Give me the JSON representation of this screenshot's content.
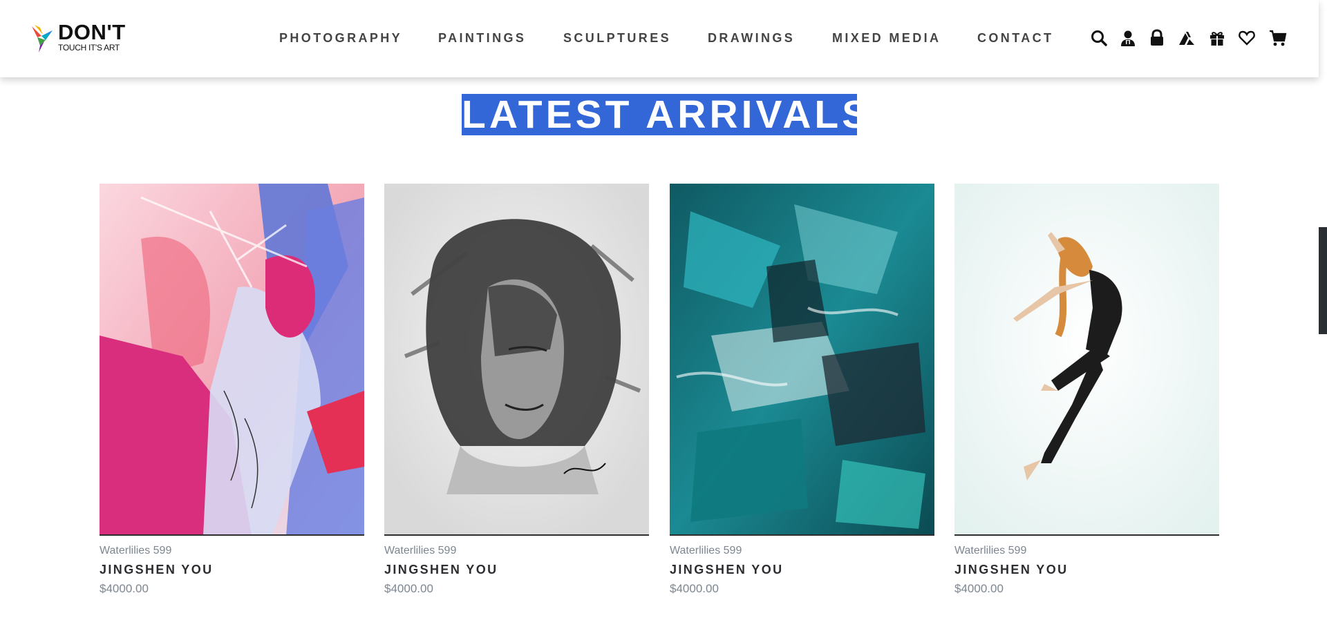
{
  "brand": {
    "name": "DON'T",
    "tagline": "TOUCH IT'S ART"
  },
  "nav": {
    "items": [
      {
        "label": "PHOTOGRAPHY"
      },
      {
        "label": "PAINTINGS"
      },
      {
        "label": "SCULPTURES"
      },
      {
        "label": "DRAWINGS"
      },
      {
        "label": "MIXED MEDIA"
      },
      {
        "label": "CONTACT"
      }
    ]
  },
  "header_icons": [
    "search-icon",
    "account-icon",
    "lock-icon",
    "artist-icon",
    "gift-icon",
    "wishlist-heart-icon",
    "cart-icon"
  ],
  "section": {
    "title": "LATEST ARRIVALS",
    "highlight_color": "#3366d6"
  },
  "products": [
    {
      "series": "Waterlilies 599",
      "artist": "JINGSHEN YOU",
      "price": "$4000.00"
    },
    {
      "series": "Waterlilies 599",
      "artist": "JINGSHEN YOU",
      "price": "$4000.00"
    },
    {
      "series": "Waterlilies 599",
      "artist": "JINGSHEN YOU",
      "price": "$4000.00"
    },
    {
      "series": "Waterlilies 599",
      "artist": "JINGSHEN YOU",
      "price": "$4000.00"
    }
  ],
  "colors": {
    "text_dark": "#2b2d30",
    "text_muted": "#7d8690",
    "nav_text": "#444444"
  }
}
